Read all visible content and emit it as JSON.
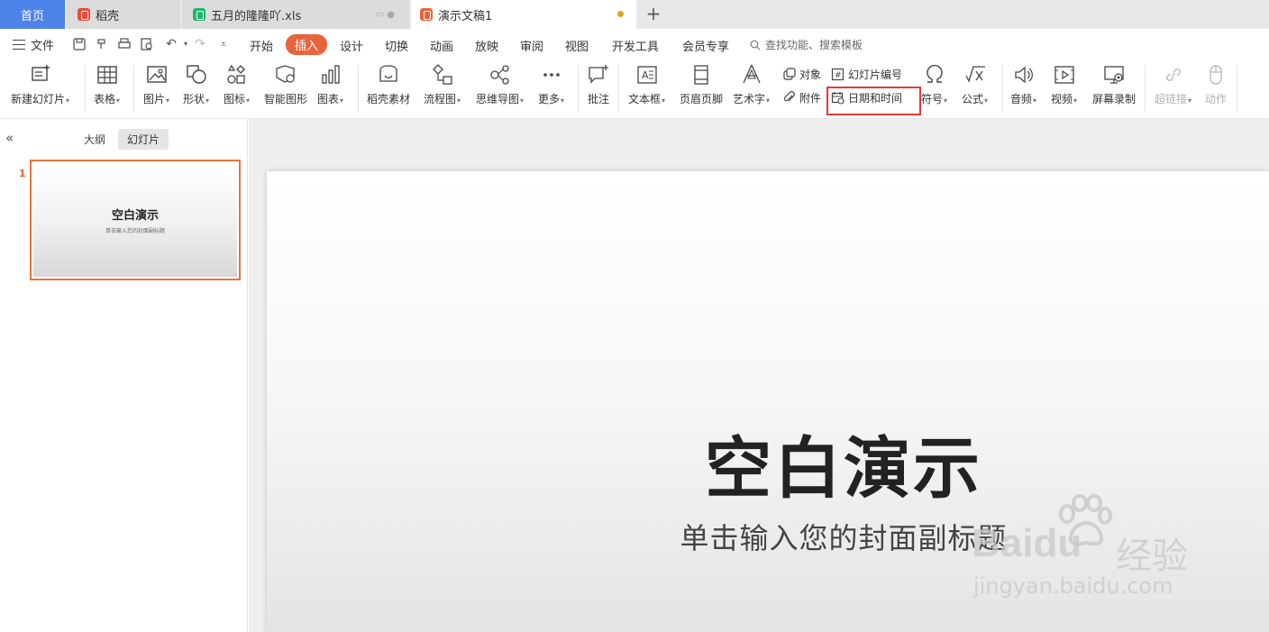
{
  "tabs": {
    "home": "首页",
    "daoke": "稻壳",
    "xls": "五月的隆隆吖.xls",
    "ppt": "演示文稿1",
    "add": "+"
  },
  "menubar": {
    "file": "文件",
    "items": [
      "开始",
      "插入",
      "设计",
      "切换",
      "动画",
      "放映",
      "审阅",
      "视图",
      "开发工具",
      "会员专享"
    ],
    "active": "插入",
    "search": "查找功能、搜索模板"
  },
  "ribbon": {
    "new_slide": "新建幻灯片",
    "table": "表格",
    "picture": "图片",
    "shape": "形状",
    "icon": "图标",
    "smartart": "智能图形",
    "chart": "图表",
    "daoke_material": "稻壳素材",
    "flowchart": "流程图",
    "mindmap": "思维导图",
    "more": "更多",
    "comment": "批注",
    "textbox": "文本框",
    "header_footer": "页眉页脚",
    "wordart": "艺术字",
    "object": "对象",
    "attachment": "附件",
    "slide_number": "幻灯片编号",
    "date_time": "日期和时间",
    "symbol": "符号",
    "formula": "公式",
    "audio": "音频",
    "video": "视频",
    "screen_record": "屏幕录制",
    "hyperlink": "超链接",
    "action": "动作"
  },
  "panel": {
    "collapse": "«",
    "outline_tab": "大纲",
    "slides_tab": "幻灯片",
    "slide_number": "1",
    "thumb_title": "空白演示",
    "thumb_subtitle": "单击输入您的封面副标题"
  },
  "slide": {
    "title": "空白演示",
    "subtitle": "单击输入您的封面副标题"
  },
  "watermark": {
    "brand": "Baidu",
    "cn": "经验",
    "url": "jingyan.baidu.com"
  },
  "colors": {
    "accent": "#e9643b",
    "home_tab": "#4d82e8",
    "highlight": "#e53935"
  }
}
